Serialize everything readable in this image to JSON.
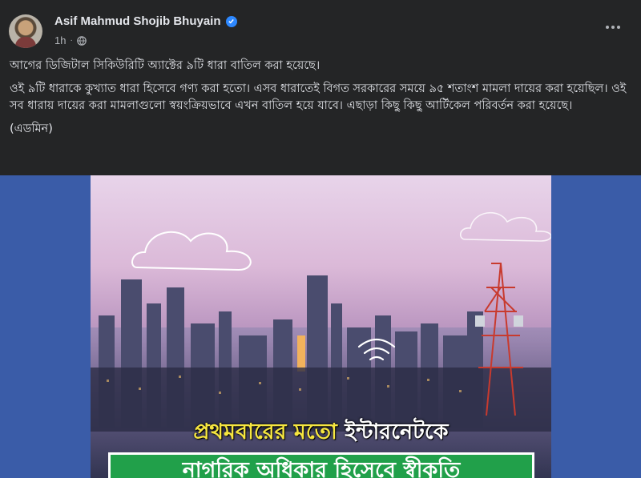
{
  "post": {
    "author": "Asif Mahmud Shojib Bhuyain",
    "time": "1h",
    "paragraphs": [
      "আগের ডিজিটাল সিকিউরিটি অ্যাক্টের ৯টি ধারা বাতিল করা হয়েছে।",
      "ওই ৯টি ধারাকে কুখ্যাত ধারা হিসেবে গণ্য করা হতো। এসব ধারাতেই বিগত সরকারের সময়ে ৯৫ শতাংশ মামলা দায়ের করা হয়েছিল। ওই সব ধারায় দায়ের করা মামলাগুলো স্বয়ংক্রিয়ভাবে এখন বাতিল হয়ে যাবে। এছাড়া কিছু কিছু আর্টিকেল পরিবর্তন করা হয়েছে।",
      "(এডমিন)"
    ]
  },
  "image": {
    "headline_part1": "প্রথমবারের মতো",
    "headline_part2": "ইন্টারনেটকে",
    "banner": "নাগরিক অধিকার হিসেবে স্বীকৃতি"
  },
  "colors": {
    "background": "#242526",
    "accent": "#2d88ff",
    "banner": "#21a04a",
    "headline_highlight": "#f6e640"
  },
  "icons": {
    "verified": "verified-badge-icon",
    "privacy": "globe-icon",
    "more": "more-options-icon"
  }
}
